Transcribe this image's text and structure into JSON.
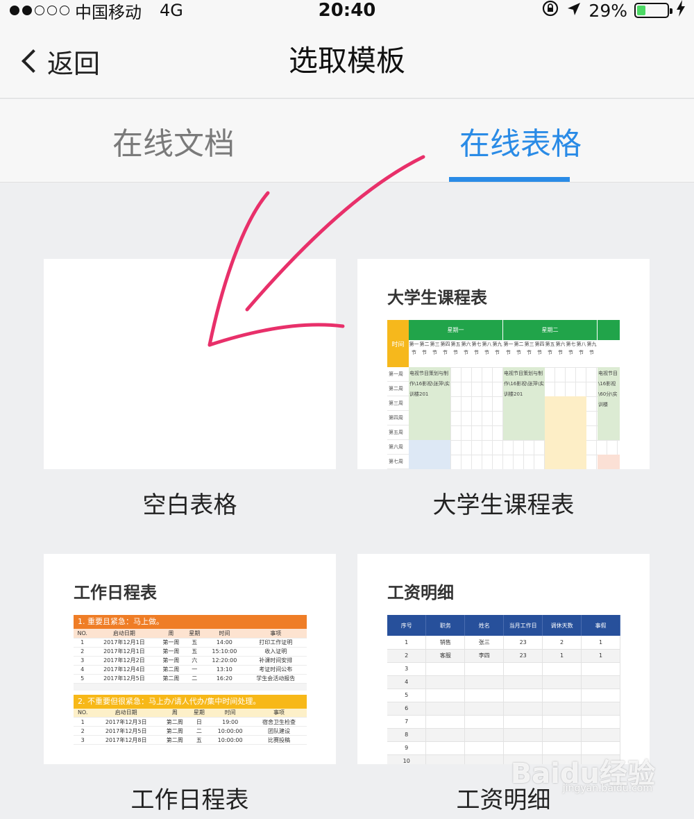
{
  "status": {
    "carrier": "中国移动",
    "network": "4G",
    "time": "20:40",
    "battery_pct": "29%",
    "battery_level": 0.29
  },
  "nav": {
    "back_label": "返回",
    "title": "选取模板"
  },
  "tabs": [
    {
      "label": "在线文档",
      "active": false
    },
    {
      "label": "在线表格",
      "active": true
    }
  ],
  "templates": {
    "blank": {
      "label": "空白表格"
    },
    "course": {
      "label": "大学生课程表",
      "thumb_title": "大学生课程表",
      "time_header": "时间",
      "days": [
        "星期一",
        "星期二"
      ],
      "periods": [
        "第一节",
        "第二节",
        "第三节",
        "第四节",
        "第五节",
        "第六节",
        "第七节",
        "第八节",
        "第九节"
      ],
      "weeks": [
        "第一周",
        "第二周",
        "第三周",
        "第四周",
        "第五周",
        "第六周",
        "第七周"
      ],
      "block1": "电视节目策划与制作\\16影视\\张萍\\实训楼201",
      "block2": "电视节目策划与制作\\16影视\\张萍\\实训楼201",
      "block3": "电视节目\\16影视\\60分\\实训楼"
    },
    "work": {
      "label": "工作日程表",
      "thumb_title": "工作日程表",
      "section1": "1. 重要且紧急：马上做。",
      "section2": "2. 不重要但很紧急：马上办/请人代办/集中时间处理。",
      "headers": [
        "NO.",
        "启动日期",
        "周",
        "星期",
        "时间",
        "事项"
      ],
      "rows1": [
        [
          "1",
          "2017年12月1日",
          "第一周",
          "五",
          "14:00",
          "打印工作证明"
        ],
        [
          "2",
          "2017年12月1日",
          "第一周",
          "五",
          "15:10:00",
          "收入证明"
        ],
        [
          "3",
          "2017年12月2日",
          "第一周",
          "六",
          "12:20:00",
          "补课时间安排"
        ],
        [
          "4",
          "2017年12月4日",
          "第二周",
          "一",
          "13:10",
          "考证时间公布"
        ],
        [
          "5",
          "2017年12月5日",
          "第二周",
          "二",
          "16:20",
          "学生会活动报告"
        ]
      ],
      "rows2": [
        [
          "1",
          "2017年12月3日",
          "第二周",
          "日",
          "19:00",
          "宿舍卫生检查"
        ],
        [
          "2",
          "2017年12月5日",
          "第二周",
          "二",
          "10:00:00",
          "团队建设"
        ],
        [
          "3",
          "2017年12月8日",
          "第二周",
          "五",
          "10:00:00",
          "比赛投稿"
        ]
      ]
    },
    "salary": {
      "label": "工资明细",
      "thumb_title": "工资明细",
      "headers": [
        "序号",
        "职务",
        "姓名",
        "当月工作日",
        "调休天数",
        "事假"
      ],
      "rows": [
        [
          "1",
          "销售",
          "张三",
          "23",
          "2",
          "1"
        ],
        [
          "2",
          "客服",
          "李四",
          "23",
          "1",
          "1"
        ],
        [
          "3",
          "",
          "",
          "",
          "",
          ""
        ],
        [
          "4",
          "",
          "",
          "",
          "",
          ""
        ],
        [
          "5",
          "",
          "",
          "",
          "",
          ""
        ],
        [
          "6",
          "",
          "",
          "",
          "",
          ""
        ],
        [
          "7",
          "",
          "",
          "",
          "",
          ""
        ],
        [
          "8",
          "",
          "",
          "",
          "",
          ""
        ],
        [
          "9",
          "",
          "",
          "",
          "",
          ""
        ],
        [
          "10",
          "",
          "",
          "",
          "",
          ""
        ]
      ]
    }
  },
  "watermark": {
    "brand": "Baidu经验",
    "url": "jingyan.baidu.com"
  },
  "colors": {
    "accent": "#2a8be6",
    "arrow": "#e8306a",
    "schedule_green": "#21a44a",
    "work_orange": "#ef7d26",
    "salary_blue": "#27509b"
  }
}
